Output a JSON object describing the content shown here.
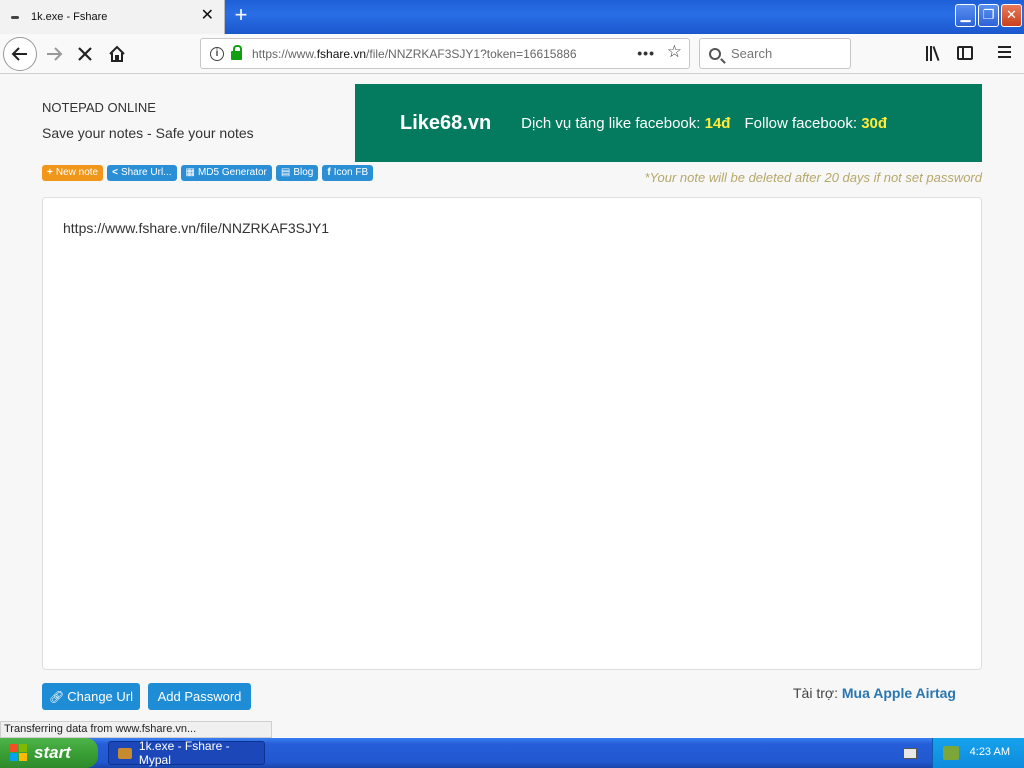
{
  "browser": {
    "tab_title": "1k.exe - Fshare",
    "url_prefix": "https://www.",
    "url_domain": "fshare.vn",
    "url_rest": "/file/NNZRKAF3SJY1?token=16615886",
    "search_placeholder": "Search"
  },
  "header": {
    "brand_title": "NOTEPAD ONLINE",
    "brand_subtitle": "Save your notes - Safe your notes"
  },
  "ad": {
    "name": "Like68.vn",
    "like_text": "Dịch vụ tăng like facebook:",
    "like_price": "14đ",
    "follow_text": "Follow facebook:",
    "follow_price": "30đ",
    "bg_color": "#047a5f",
    "price_color": "#ffeb3b"
  },
  "toolbar": {
    "new_note": "New note",
    "share_url": "Share Url...",
    "md5": "MD5 Generator",
    "blog": "Blog",
    "icon_fb": "Icon FB"
  },
  "notice": "*Your note will be deleted after 20 days if not set password",
  "editor": {
    "content": "https://www.fshare.vn/file/NNZRKAF3SJY1"
  },
  "actions": {
    "change_url": "Change Url",
    "add_password": "Add Password"
  },
  "sponsor": {
    "label": "Tài trợ:",
    "link": "Mua Apple Airtag"
  },
  "status_text": "Transferring data from www.fshare.vn...",
  "taskbar": {
    "start_label": "start",
    "task_label": "1k.exe - Fshare - Mypal",
    "clock": "4:23 AM"
  }
}
